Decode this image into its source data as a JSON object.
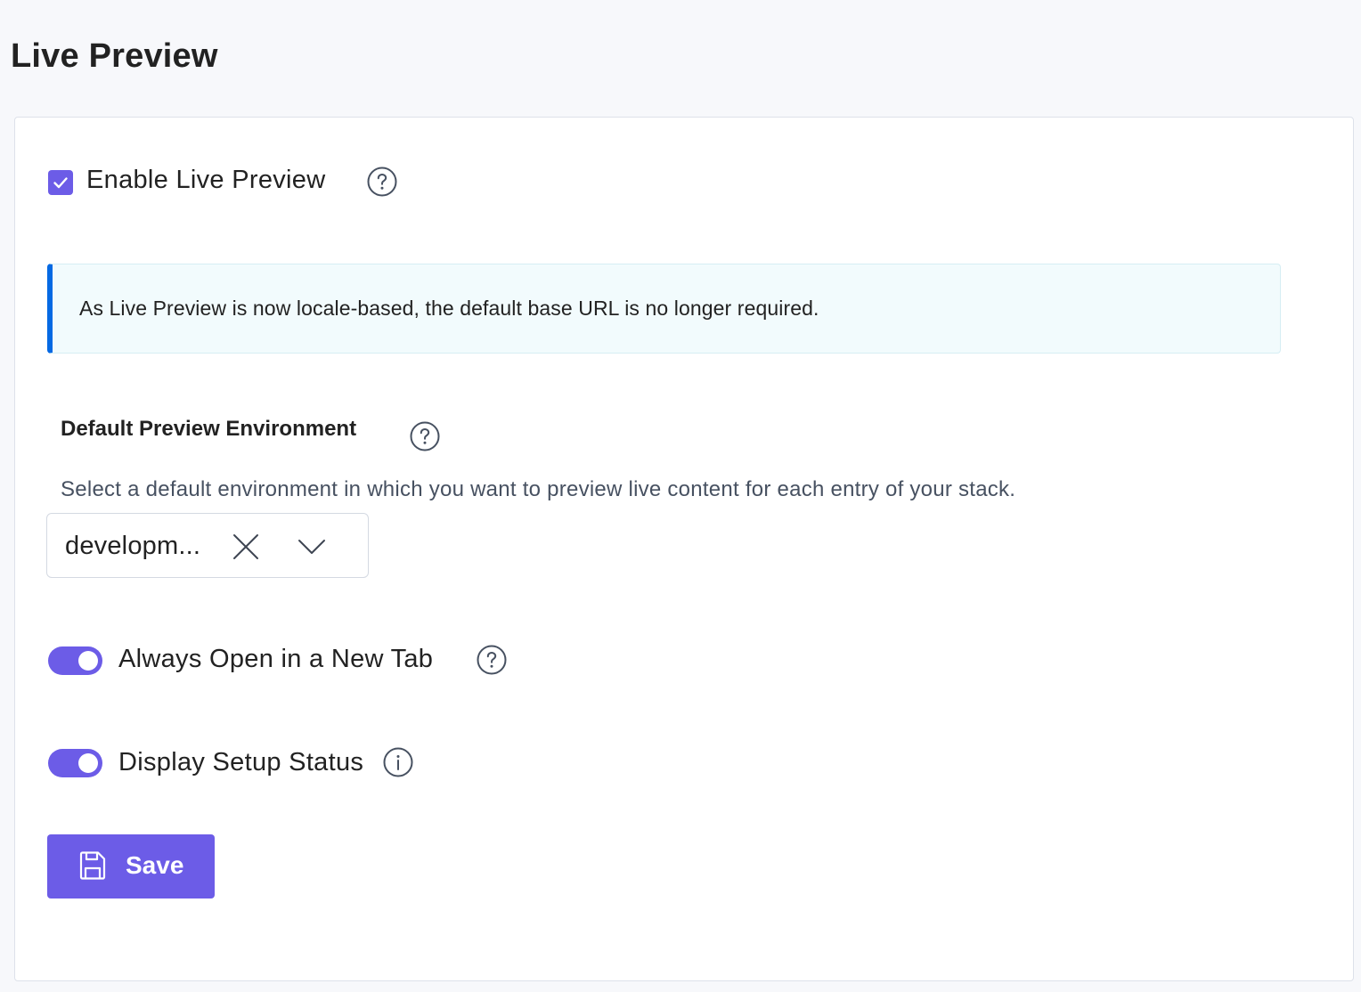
{
  "page": {
    "title": "Live Preview"
  },
  "enable_live_preview": {
    "label": "Enable Live Preview",
    "checked": true,
    "help_icon": "question-circle-icon"
  },
  "info_banner": {
    "text": "As Live Preview is now locale-based, the default base URL is no longer required."
  },
  "default_environment": {
    "label": "Default Preview Environment",
    "help_icon": "question-circle-icon",
    "description": "Select a default environment in which you want to preview live content for each entry of your stack.",
    "selected_value": "developm...",
    "clear_icon": "close-icon",
    "dropdown_icon": "chevron-down-icon"
  },
  "always_open_new_tab": {
    "label": "Always Open in a New Tab",
    "enabled": true,
    "help_icon": "question-circle-icon"
  },
  "display_setup_status": {
    "label": "Display Setup Status",
    "enabled": true,
    "info_icon": "info-circle-icon"
  },
  "save_button": {
    "label": "Save",
    "icon": "floppy-disk-icon"
  },
  "colors": {
    "accent": "#6c5ce7",
    "banner_border": "#0469e3",
    "banner_background": "#f2fbfd",
    "page_background": "#f7f8fb"
  }
}
